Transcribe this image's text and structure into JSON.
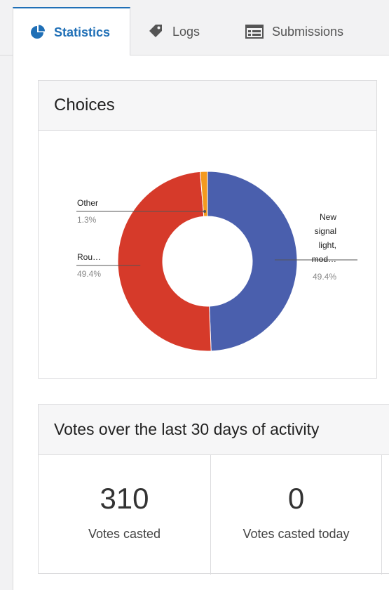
{
  "tabs": {
    "statistics": "Statistics",
    "logs": "Logs",
    "submissions": "Submissions"
  },
  "choices_panel": {
    "title": "Choices"
  },
  "chart_data": {
    "type": "pie",
    "donut": true,
    "slices": [
      {
        "label": "New signal light, mod…",
        "value": 49.4,
        "value_label": "49.4%",
        "color": "#4a5fad"
      },
      {
        "label": "Rou…",
        "value": 49.4,
        "value_label": "49.4%",
        "color": "#d63a2a"
      },
      {
        "label": "Other",
        "value": 1.3,
        "value_label": "1.3%",
        "color": "#f39a1e"
      }
    ]
  },
  "votes_panel": {
    "title": "Votes over the last 30 days of activity",
    "stats": [
      {
        "value": "310",
        "label": "Votes casted"
      },
      {
        "value": "0",
        "label": "Votes casted today"
      }
    ]
  },
  "colors": {
    "accent": "#1f6fb6",
    "slice_new_signal": "#4a5fad",
    "slice_rou": "#d63a2a",
    "slice_other": "#f39a1e"
  }
}
